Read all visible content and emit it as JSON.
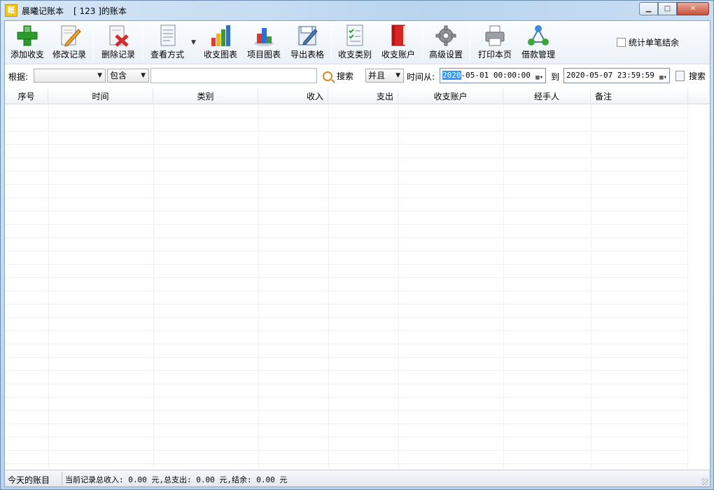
{
  "window": {
    "title_app": "晨曦记账本",
    "title_book": "[ 123 ]的账本",
    "app_icon_text": "账",
    "buttons": {
      "minimize": "▭",
      "maximize": "□",
      "close": "✕"
    }
  },
  "toolbar": {
    "items": [
      {
        "label": "添加收支",
        "icon": "add-icon"
      },
      {
        "label": "修改记录",
        "icon": "edit-icon"
      },
      {
        "label": "删除记录",
        "icon": "delete-icon"
      },
      {
        "label": "查看方式",
        "icon": "view-icon"
      },
      {
        "label": "收支图表",
        "icon": "bar-chart-icon"
      },
      {
        "label": "项目图表",
        "icon": "project-chart-icon"
      },
      {
        "label": "导出表格",
        "icon": "export-icon"
      },
      {
        "label": "收支类别",
        "icon": "category-icon"
      },
      {
        "label": "收支账户",
        "icon": "account-book-icon"
      },
      {
        "label": "高级设置",
        "icon": "gear-icon"
      },
      {
        "label": "打印本页",
        "icon": "printer-icon"
      },
      {
        "label": "借款管理",
        "icon": "network-icon"
      }
    ],
    "view_dropdown_caret": "▼",
    "stat_checkbox_label": "统计单笔结余",
    "stat_checkbox_checked": false
  },
  "search": {
    "basis_label": "根据:",
    "field_select": "",
    "match_select": "包含",
    "keyword": "",
    "search_label": "搜索",
    "logic_select": "并且",
    "time_from_label": "时间从:",
    "from_year": "2020",
    "from_rest": "-05-01 00:00:00",
    "to_label": "到",
    "to_datetime": "2020-05-07 23:59:59",
    "search2_label": "搜索"
  },
  "table": {
    "columns": [
      "序号",
      "时间",
      "类别",
      "收入",
      "支出",
      "收支账户",
      "经手人",
      "备注"
    ],
    "rows": []
  },
  "status": {
    "left": "今天的账目",
    "summary": "当前记录总收入: 0.00 元,总支出: 0.00 元,结余: 0.00 元"
  },
  "colors": {
    "accent": "#3399ff",
    "titlebar": "#c4dbf2"
  }
}
